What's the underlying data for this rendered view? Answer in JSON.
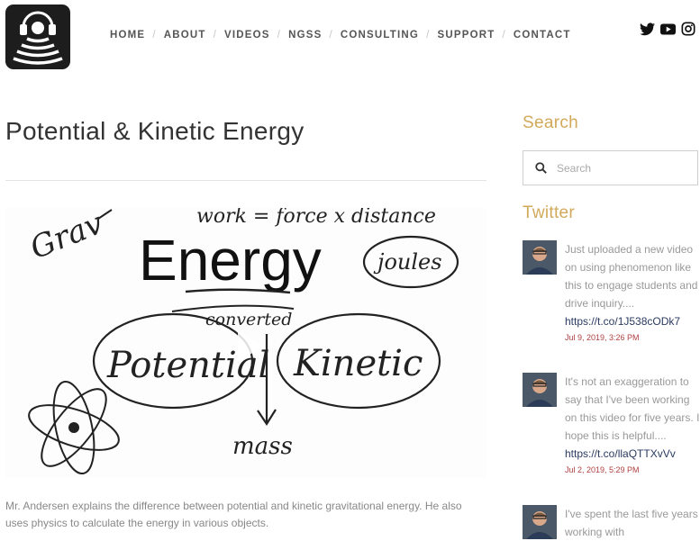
{
  "nav": {
    "items": [
      "HOME",
      "ABOUT",
      "VIDEOS",
      "NGSS",
      "CONSULTING",
      "SUPPORT",
      "CONTACT"
    ],
    "separator": "/"
  },
  "social": {
    "icons": [
      "twitter-icon",
      "youtube-icon",
      "instagram-icon"
    ]
  },
  "post": {
    "title": "Potential & Kinetic Energy",
    "description": "Mr. Andersen explains the difference between potential and kinetic gravitational energy. He also uses physics to calculate the energy in various objects.",
    "whiteboard": {
      "heading": "Energy",
      "top_text": "work = force x distance",
      "corner_text": "Grav",
      "bubble_units": "joules",
      "connector": "converted",
      "left_bubble": "Potential",
      "right_bubble": "Kinetic",
      "bottom_text": "mass"
    }
  },
  "sidebar": {
    "search_heading": "Search",
    "search_placeholder": "Search",
    "twitter_heading": "Twitter",
    "tweets": [
      {
        "text": "Just uploaded a new video on using phenomenon like this to engage students and drive inquiry....",
        "link": "https://t.co/1J538cODk7",
        "date": "Jul 9, 2019, 3:26 PM"
      },
      {
        "text": "It's not an exaggeration to say that I've been working on this video for five years. I hope this is helpful....",
        "link": "https://t.co/llaQTTXvVv",
        "date": "Jul 2, 2019, 5:29 PM"
      },
      {
        "text": "I've spent the last five years working with",
        "link": "",
        "date": ""
      }
    ]
  },
  "colors": {
    "accent": "#d2a95a",
    "link": "#2a3a60",
    "date": "#b04040",
    "logo_bg": "#1d1d1d"
  }
}
